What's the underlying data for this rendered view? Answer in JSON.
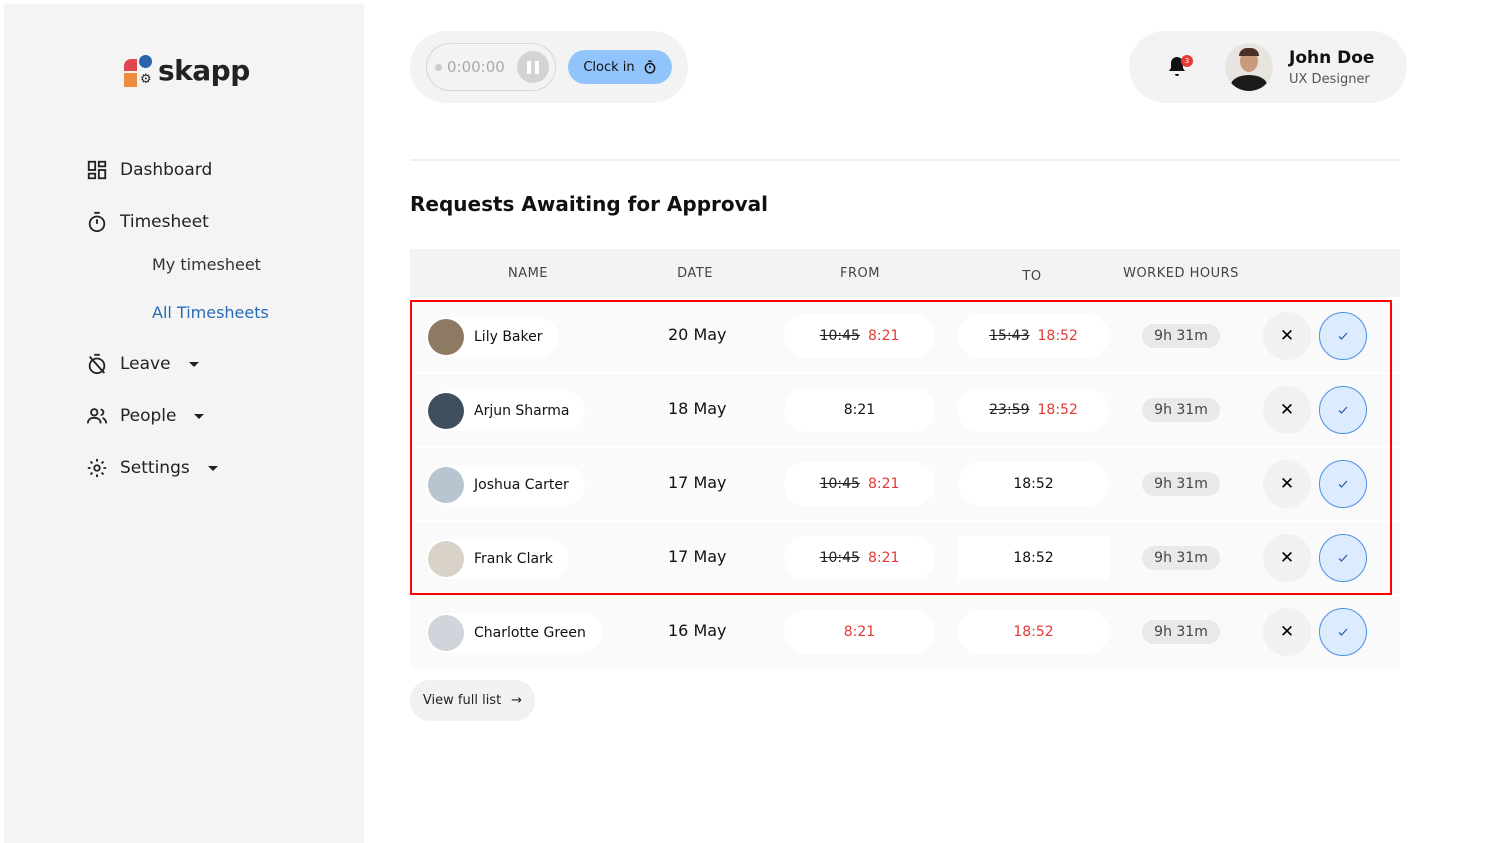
{
  "brand": {
    "name": "skapp"
  },
  "sidebar": {
    "items": [
      {
        "label": "Dashboard",
        "icon": "dashboard-icon"
      },
      {
        "label": "Timesheet",
        "icon": "stopwatch-icon"
      },
      {
        "label": "My timesheet"
      },
      {
        "label": "All Timesheets",
        "active": true
      },
      {
        "label": "Leave",
        "icon": "leave-icon"
      },
      {
        "label": "People",
        "icon": "people-icon"
      },
      {
        "label": "Settings",
        "icon": "gear-icon"
      }
    ]
  },
  "header": {
    "timer": "0:00:00",
    "clock_in": "Clock in",
    "notifications": "3",
    "user_name": "John Doe",
    "user_role": "UX Designer"
  },
  "main": {
    "title": "Requests Awaiting for Approval",
    "columns": [
      "NAME",
      "DATE",
      "FROM",
      "TO",
      "WORKED HOURS"
    ],
    "rows": [
      {
        "name": "Lily Baker",
        "date": "20 May",
        "from_old": "10:45",
        "from_new": "8:21",
        "to_old": "15:43",
        "to_new": "18:52",
        "hours": "9h 31m"
      },
      {
        "name": "Arjun Sharma",
        "date": "18 May",
        "from_old": "",
        "from_new": "8:21",
        "to_old": "23:59",
        "to_new": "18:52",
        "hours": "9h 31m"
      },
      {
        "name": "Joshua Carter",
        "date": "17 May",
        "from_old": "10:45",
        "from_new": "8:21",
        "to_old": "",
        "to_new": "18:52",
        "hours": "9h 31m"
      },
      {
        "name": "Frank Clark",
        "date": "17 May",
        "from_old": "10:45",
        "from_new": "8:21",
        "to_old": "",
        "to_new": "18:52",
        "hours": "9h 31m"
      },
      {
        "name": "Charlotte Green",
        "date": "16 May",
        "from_old": "",
        "from_new": "8:21",
        "to_old": "",
        "to_new": "18:52",
        "hours": "9h 31m"
      }
    ],
    "view_full": "View full list"
  },
  "colors": {
    "accent": "#90c4fb",
    "active_nav": "#2a6bb8",
    "changed_time": "#e53935",
    "highlight": "#ff0000"
  }
}
